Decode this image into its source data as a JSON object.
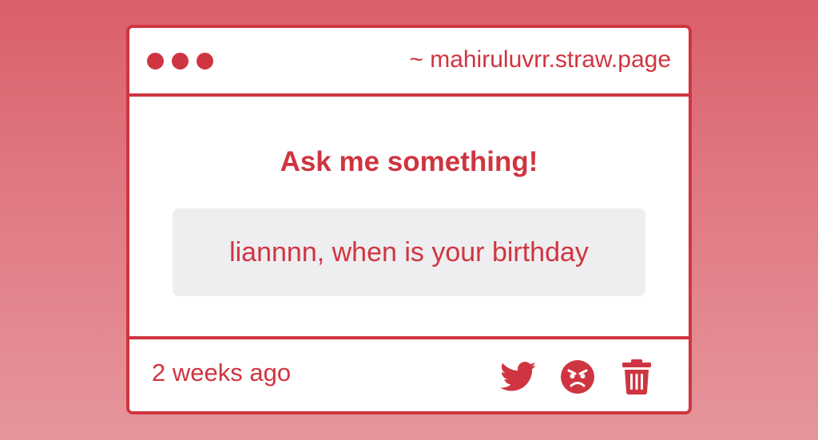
{
  "window": {
    "url": "~ mahiruluvrr.straw.page"
  },
  "card": {
    "heading": "Ask me something!",
    "question": "liannnn, when is your birthday",
    "timestamp": "2 weeks ago"
  },
  "actions": [
    {
      "icon": "twitter-icon",
      "name": "share-twitter"
    },
    {
      "icon": "angry-face-icon",
      "name": "react-angry"
    },
    {
      "icon": "trash-icon",
      "name": "delete"
    }
  ],
  "colors": {
    "accent": "#cf3540",
    "background_top": "#da5f6b",
    "background_bottom": "#e6959c",
    "question_bg": "#eeedef"
  }
}
